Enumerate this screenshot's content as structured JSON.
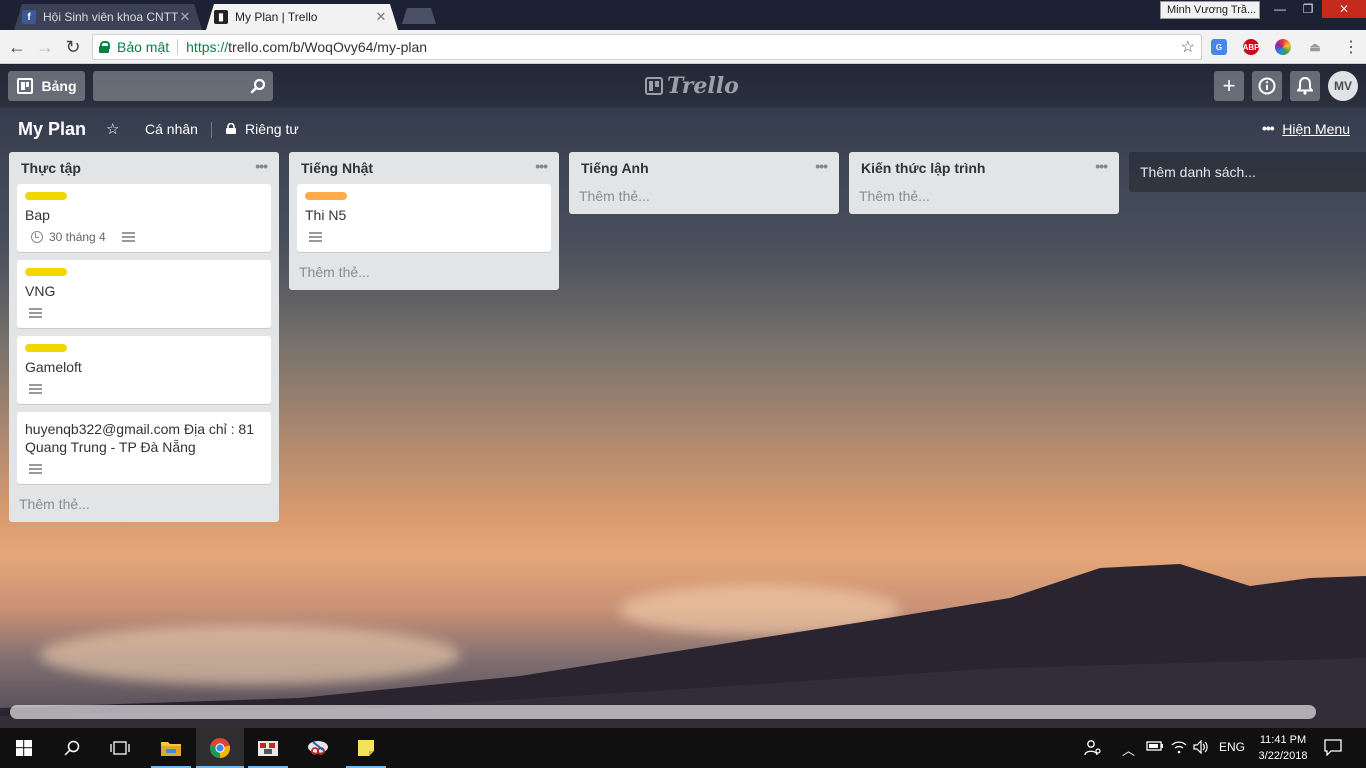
{
  "browser": {
    "tabs": [
      {
        "title": "Hội Sinh viên khoa CNTT",
        "active": false,
        "favicon": "facebook-icon"
      },
      {
        "title": "My Plan | Trello",
        "active": true,
        "favicon": "trello-icon"
      }
    ],
    "profile_name": "Minh Vương Trầ...",
    "secure_label": "Bảo mật",
    "url_scheme": "https://",
    "url_rest": "trello.com/b/WoqOvy64/my-plan",
    "extensions": [
      "google-translate-icon",
      "adblock-plus-icon",
      "color-picker-icon",
      "extension-icon"
    ]
  },
  "trello": {
    "boards_button": "Bảng",
    "search_placeholder": "",
    "logo_text": "Trello",
    "avatar_initials": "MV",
    "board": {
      "title": "My Plan",
      "team": "Cá nhân",
      "visibility": "Riêng tư",
      "show_menu": "Hiện Menu"
    },
    "lists": [
      {
        "name": "Thực tập",
        "add_card": "Thêm thẻ...",
        "cards": [
          {
            "title": "Bap",
            "label_color": "#f2d600",
            "due": "30 tháng 4",
            "has_description": true
          },
          {
            "title": "VNG",
            "label_color": "#f2d600",
            "has_description": true
          },
          {
            "title": "Gameloft",
            "label_color": "#f2d600",
            "has_description": true
          },
          {
            "title": "huyenqb322@gmail.com Địa chỉ : 81 Quang Trung - TP Đà Nẵng",
            "has_description": true
          }
        ]
      },
      {
        "name": "Tiếng Nhật",
        "add_card": "Thêm thẻ...",
        "cards": [
          {
            "title": "Thi N5",
            "label_color": "#ffab4a",
            "has_description": true
          }
        ]
      },
      {
        "name": "Tiếng Anh",
        "add_card": "Thêm thẻ...",
        "cards": []
      },
      {
        "name": "Kiến thức lập trình",
        "add_card": "Thêm thẻ...",
        "cards": []
      }
    ],
    "add_list": "Thêm danh sách..."
  },
  "taskbar": {
    "language": "ENG",
    "time": "11:41 PM",
    "date": "3/22/2018"
  }
}
